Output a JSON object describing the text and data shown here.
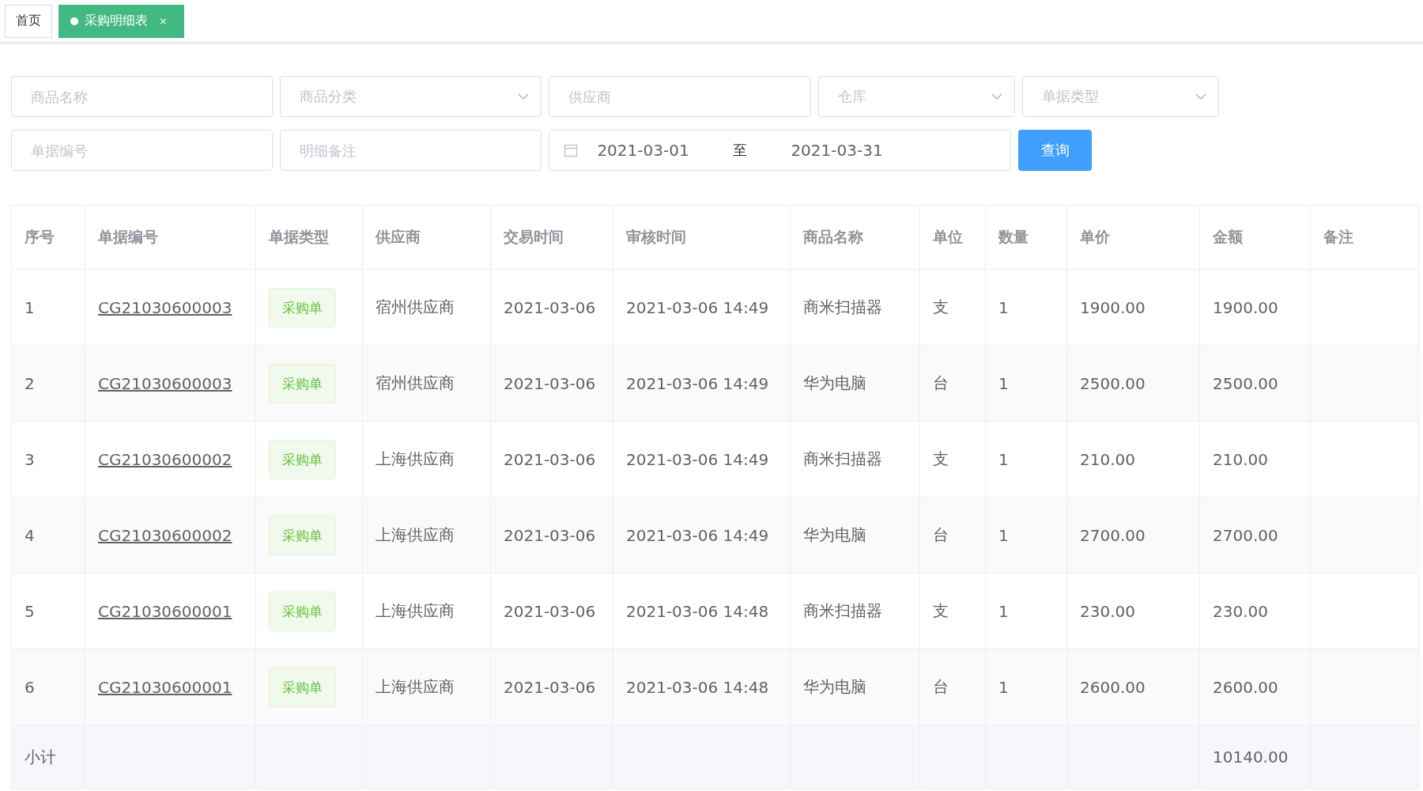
{
  "tabs": [
    {
      "label": "首页",
      "selected": false
    },
    {
      "label": "采购明细表",
      "selected": true,
      "close": "×"
    }
  ],
  "filters": [
    [
      {
        "kind": "text",
        "placeholder": "商品名称"
      },
      {
        "kind": "select",
        "placeholder": "商品分类"
      },
      {
        "kind": "text",
        "placeholder": "供应商"
      },
      {
        "kind": "select",
        "placeholder": "仓库"
      },
      {
        "kind": "select",
        "placeholder": "单据类型"
      }
    ],
    [
      {
        "kind": "text",
        "placeholder": "单据编号"
      },
      {
        "kind": "text",
        "placeholder": "明细备注"
      },
      {
        "kind": "daterange",
        "start": "2021-03-01",
        "separator": "至",
        "end": "2021-03-31"
      }
    ]
  ],
  "search_button": "查询",
  "table": {
    "columns": [
      "序号",
      "单据编号",
      "单据类型",
      "供应商",
      "交易时间",
      "审核时间",
      "商品名称",
      "单位",
      "数量",
      "单价",
      "金额",
      "备注"
    ],
    "rows": [
      {
        "index": "1",
        "order_no": "CG21030600003",
        "type": "采购单",
        "supplier": "宿州供应商",
        "trade_time": "2021-03-06",
        "audit_time": "2021-03-06 14:49",
        "product": "商米扫描器",
        "unit": "支",
        "qty": "1",
        "price": "1900.00",
        "amount": "1900.00"
      },
      {
        "index": "2",
        "order_no": "CG21030600003",
        "type": "采购单",
        "supplier": "宿州供应商",
        "trade_time": "2021-03-06",
        "audit_time": "2021-03-06 14:49",
        "product": "华为电脑",
        "unit": "台",
        "qty": "1",
        "price": "2500.00",
        "amount": "2500.00"
      },
      {
        "index": "3",
        "order_no": "CG21030600002",
        "type": "采购单",
        "supplier": "上海供应商",
        "trade_time": "2021-03-06",
        "audit_time": "2021-03-06 14:49",
        "product": "商米扫描器",
        "unit": "支",
        "qty": "1",
        "price": "210.00",
        "amount": "210.00"
      },
      {
        "index": "4",
        "order_no": "CG21030600002",
        "type": "采购单",
        "supplier": "上海供应商",
        "trade_time": "2021-03-06",
        "audit_time": "2021-03-06 14:49",
        "product": "华为电脑",
        "unit": "台",
        "qty": "1",
        "price": "2700.00",
        "amount": "2700.00"
      },
      {
        "index": "5",
        "order_no": "CG21030600001",
        "type": "采购单",
        "supplier": "上海供应商",
        "trade_time": "2021-03-06",
        "audit_time": "2021-03-06 14:48",
        "product": "商米扫描器",
        "unit": "支",
        "qty": "1",
        "price": "230.00",
        "amount": "230.00"
      },
      {
        "index": "6",
        "order_no": "CG21030600001",
        "type": "采购单",
        "supplier": "上海供应商",
        "trade_time": "2021-03-06",
        "audit_time": "2021-03-06 14:48",
        "product": "华为电脑",
        "unit": "台",
        "qty": "1",
        "price": "2600.00",
        "amount": "2600.00"
      }
    ],
    "footer": {
      "label": "小计",
      "amount": "10140.00"
    }
  }
}
